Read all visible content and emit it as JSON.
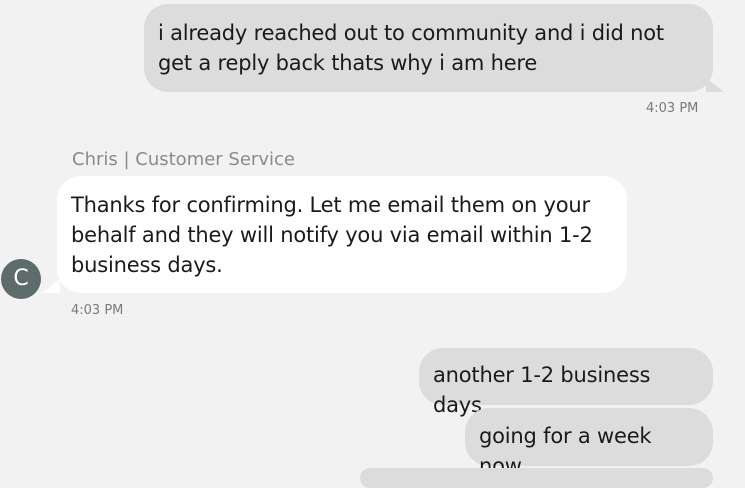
{
  "messages": [
    {
      "text": "i already reached out to community and i did not get a reply back thats why i am here",
      "time": "4:03 PM"
    },
    {
      "sender": "Chris | Customer Service",
      "text": "Thanks for confirming. Let me email them on your behalf and they will notify you via email within 1-2 business days.",
      "time": "4:03 PM",
      "avatar_initial": "C"
    },
    {
      "text": "another 1-2 business days"
    },
    {
      "text": "going for a week now"
    }
  ],
  "colors": {
    "background": "#f2f2f2",
    "user_bubble": "#dcdcdc",
    "agent_bubble": "#ffffff",
    "avatar": "#5d6b6b"
  }
}
